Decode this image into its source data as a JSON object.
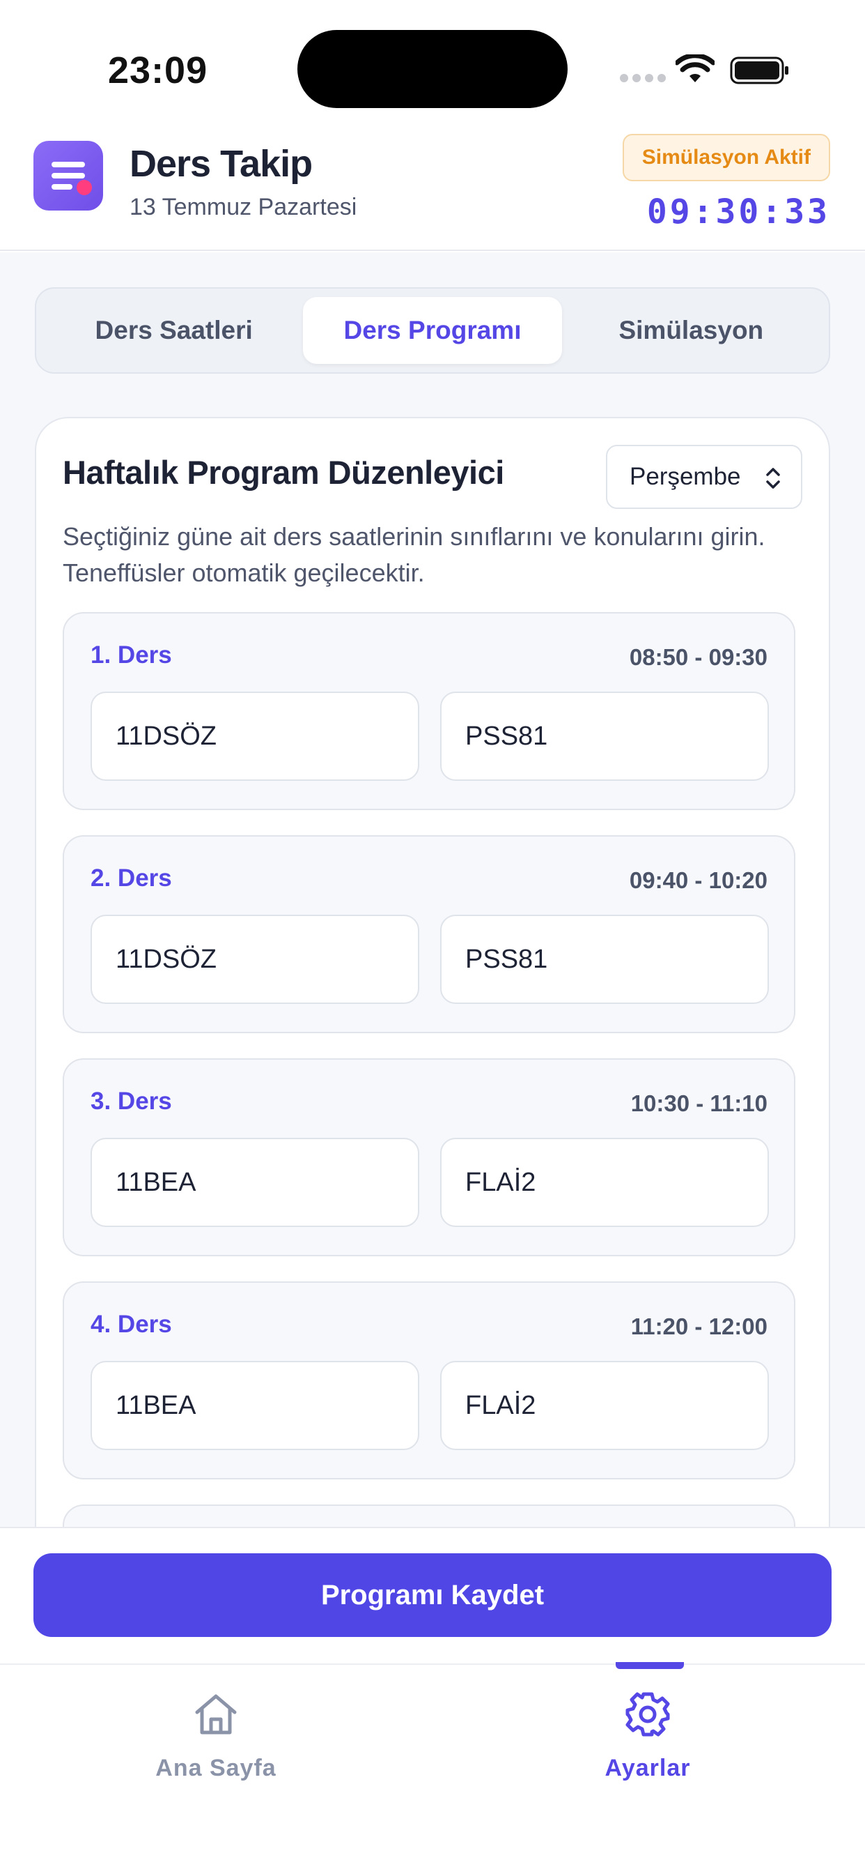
{
  "status_bar": {
    "time": "23:09"
  },
  "header": {
    "title": "Ders Takip",
    "subtitle": "13 Temmuz Pazartesi",
    "simulation_badge": "Simülasyon Aktif",
    "simulation_clock": "09:30:33",
    "accent_color": "#5546E6"
  },
  "tabs": [
    {
      "label": "Ders Saatleri",
      "active": false
    },
    {
      "label": "Ders Programı",
      "active": true
    },
    {
      "label": "Simülasyon",
      "active": false
    }
  ],
  "editor": {
    "title": "Haftalık Program Düzenleyici",
    "day_selected": "Perşembe",
    "description": "Seçtiğiniz güne ait ders saatlerinin sınıflarını ve konularını girin. Teneffüsler otomatik geçilecektir."
  },
  "lessons": [
    {
      "name": "1. Ders",
      "time": "08:50 - 09:30",
      "class": "11DSÖZ",
      "subject": "PSS81"
    },
    {
      "name": "2. Ders",
      "time": "09:40 - 10:20",
      "class": "11DSÖZ",
      "subject": "PSS81"
    },
    {
      "name": "3. Ders",
      "time": "10:30 - 11:10",
      "class": "11BEA",
      "subject": "FLAİ2"
    },
    {
      "name": "4. Ders",
      "time": "11:20 - 12:00",
      "class": "11BEA",
      "subject": "FLAİ2"
    }
  ],
  "save_button": "Programı Kaydet",
  "bottom_nav": [
    {
      "label": "Ana Sayfa",
      "icon": "home-icon",
      "active": false
    },
    {
      "label": "Ayarlar",
      "icon": "gear-icon",
      "active": true
    }
  ]
}
